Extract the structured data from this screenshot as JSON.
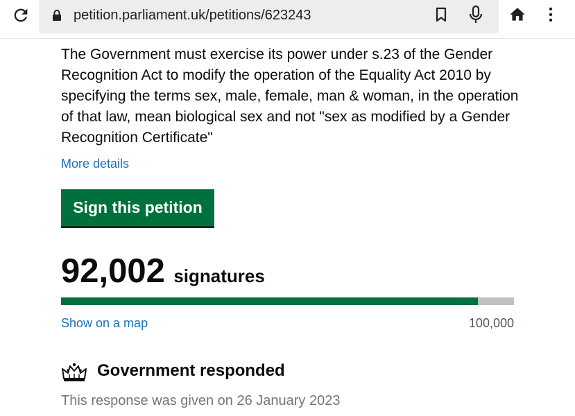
{
  "browser": {
    "url": "petition.parliament.uk/petitions/623243",
    "icons": [
      "reload-icon",
      "lock-icon",
      "bookmark-icon",
      "mic-icon",
      "home-icon",
      "menu-dots-icon"
    ]
  },
  "petition": {
    "text": "The Government must exercise its power under s.23 of the Gender Recognition Act to modify the operation of the Equality Act 2010 by specifying the terms sex, male, female, man & woman, in the operation of that law, mean biological sex and not \"sex as modified by a Gender Recognition Certificate\"",
    "more_details_label": "More details",
    "sign_label": "Sign this petition"
  },
  "signatures": {
    "count": "92,002",
    "label": "signatures",
    "progress_fraction": 0.92,
    "show_map_label": "Show on a map",
    "target": "100,000"
  },
  "response": {
    "title": "Government responded",
    "date_text": "This response was given on 26 January 2023"
  },
  "colors": {
    "link": "#1d70b8",
    "button": "#00703c",
    "progress_fill": "#00703c",
    "progress_track": "#bfc1c3"
  }
}
